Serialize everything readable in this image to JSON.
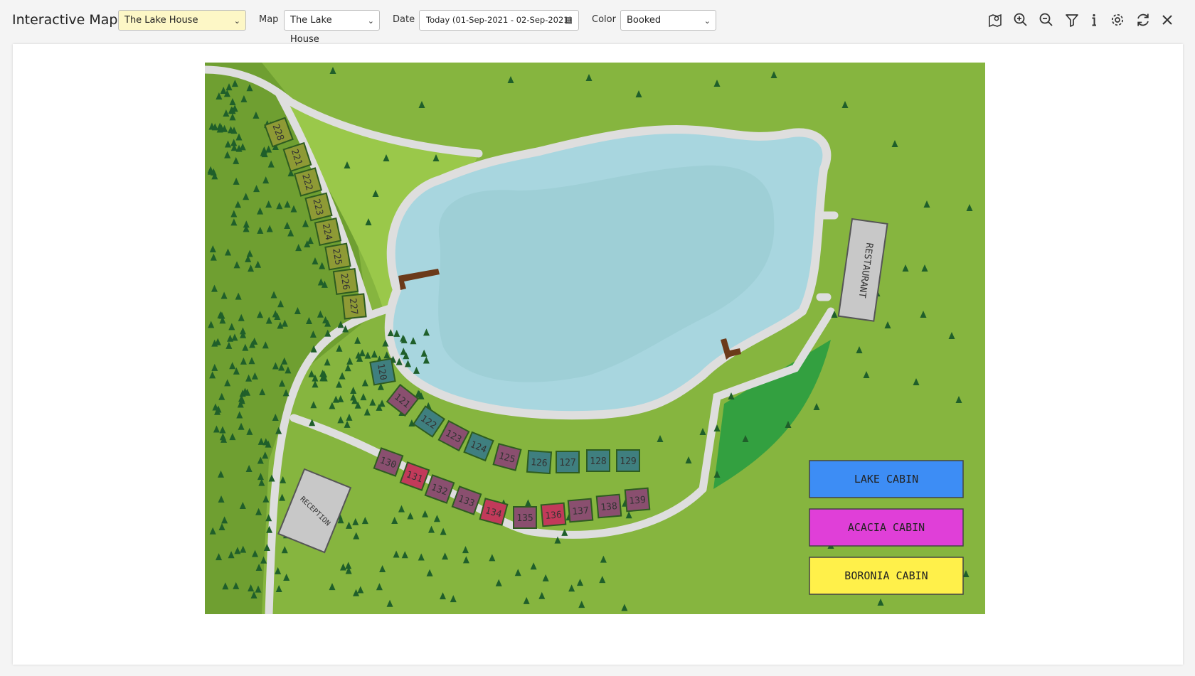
{
  "toolbar": {
    "title": "Interactive Map",
    "property_select": "The Lake House",
    "map_label": "Map",
    "map_select": "The Lake House",
    "date_label": "Date",
    "date_value": "Today (01-Sep-2021 - 02-Sep-2021)",
    "color_label": "Color",
    "color_select": "Booked",
    "icons": [
      "map-icon",
      "zoom-in-icon",
      "zoom-out-icon",
      "filter-icon",
      "info-icon",
      "settings-icon",
      "refresh-icon",
      "close-icon"
    ]
  },
  "map": {
    "restaurant": "RESTAURANT",
    "reception": "RECEPTION",
    "legend": [
      {
        "label": "LAKE CABIN",
        "color": "#3d8df5"
      },
      {
        "label": "ACACIA CABIN",
        "color": "#e03fd8"
      },
      {
        "label": "BORONIA CABIN",
        "color": "#fff04a"
      }
    ],
    "cabins_boronia": [
      "228",
      "221",
      "222",
      "223",
      "224",
      "225",
      "226",
      "227"
    ],
    "cabins_lake": [
      "120",
      "121",
      "122",
      "123",
      "124",
      "125",
      "126",
      "127",
      "128",
      "129"
    ],
    "cabins_acacia": [
      "130",
      "131",
      "132",
      "133",
      "134",
      "135",
      "136",
      "137",
      "138",
      "139"
    ]
  },
  "colors": {
    "grass": "#86b53f",
    "forest": "#6f9f31",
    "lake": "#a8d6df",
    "path": "#dedede",
    "tree": "#1f5f2a",
    "booked_lake": "#3f7f7f",
    "booked_acacia": "#8a4f6f",
    "booked_boronia": "#8e9a35"
  }
}
